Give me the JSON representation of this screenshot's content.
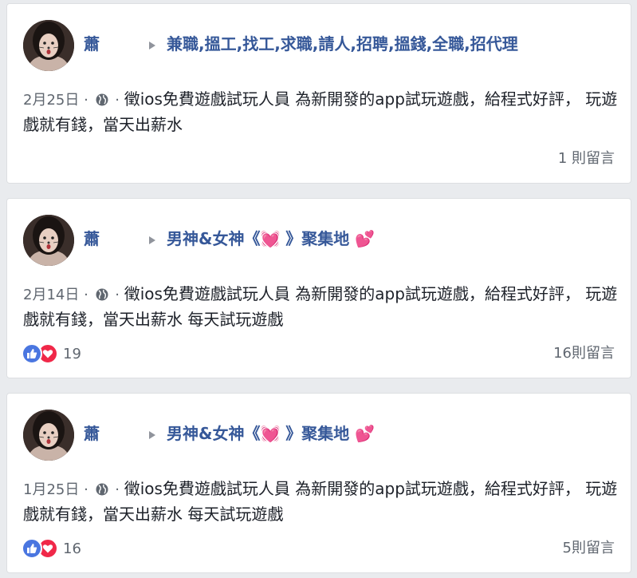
{
  "posts": [
    {
      "author": "蕭",
      "group": "兼職,搵工,找工,求職,請人,招聘,搵錢,全職,招代理",
      "date": "2月25日",
      "separator_a": " · ",
      "separator_b": " · ",
      "text": "徵ios免費遊戲試玩人員 為新開發的app試玩遊戲，給程式好評， 玩遊戲就有錢，當天出薪水",
      "reaction_count": "",
      "comments": "1 則留言"
    },
    {
      "author": "蕭",
      "group": "男神&女神《💓 》聚集地 💕",
      "date": "2月14日",
      "separator_a": " · ",
      "separator_b": " · ",
      "text": "徵ios免費遊戲試玩人員 為新開發的app試玩遊戲，給程式好評， 玩遊戲就有錢，當天出薪水 每天試玩遊戲",
      "reaction_count": "19",
      "comments": "16則留言"
    },
    {
      "author": "蕭",
      "group": "男神&女神《💓 》聚集地 💕",
      "date": "1月25日",
      "separator_a": " · ",
      "separator_b": " · ",
      "text": "徵ios免費遊戲試玩人員 為新開發的app試玩遊戲，給程式好評， 玩遊戲就有錢，當天出薪水 每天試玩遊戲",
      "reaction_count": "16",
      "comments": "5則留言"
    }
  ],
  "icons": {
    "privacy": "globe-icon",
    "share_arrow": "triangle-right-icon",
    "like": "thumbs-up-icon",
    "love": "heart-icon"
  },
  "colors": {
    "link": "#365899",
    "meta": "#606770",
    "like": "#4a76e0",
    "love": "#f02849",
    "background": "#e9ebee"
  }
}
